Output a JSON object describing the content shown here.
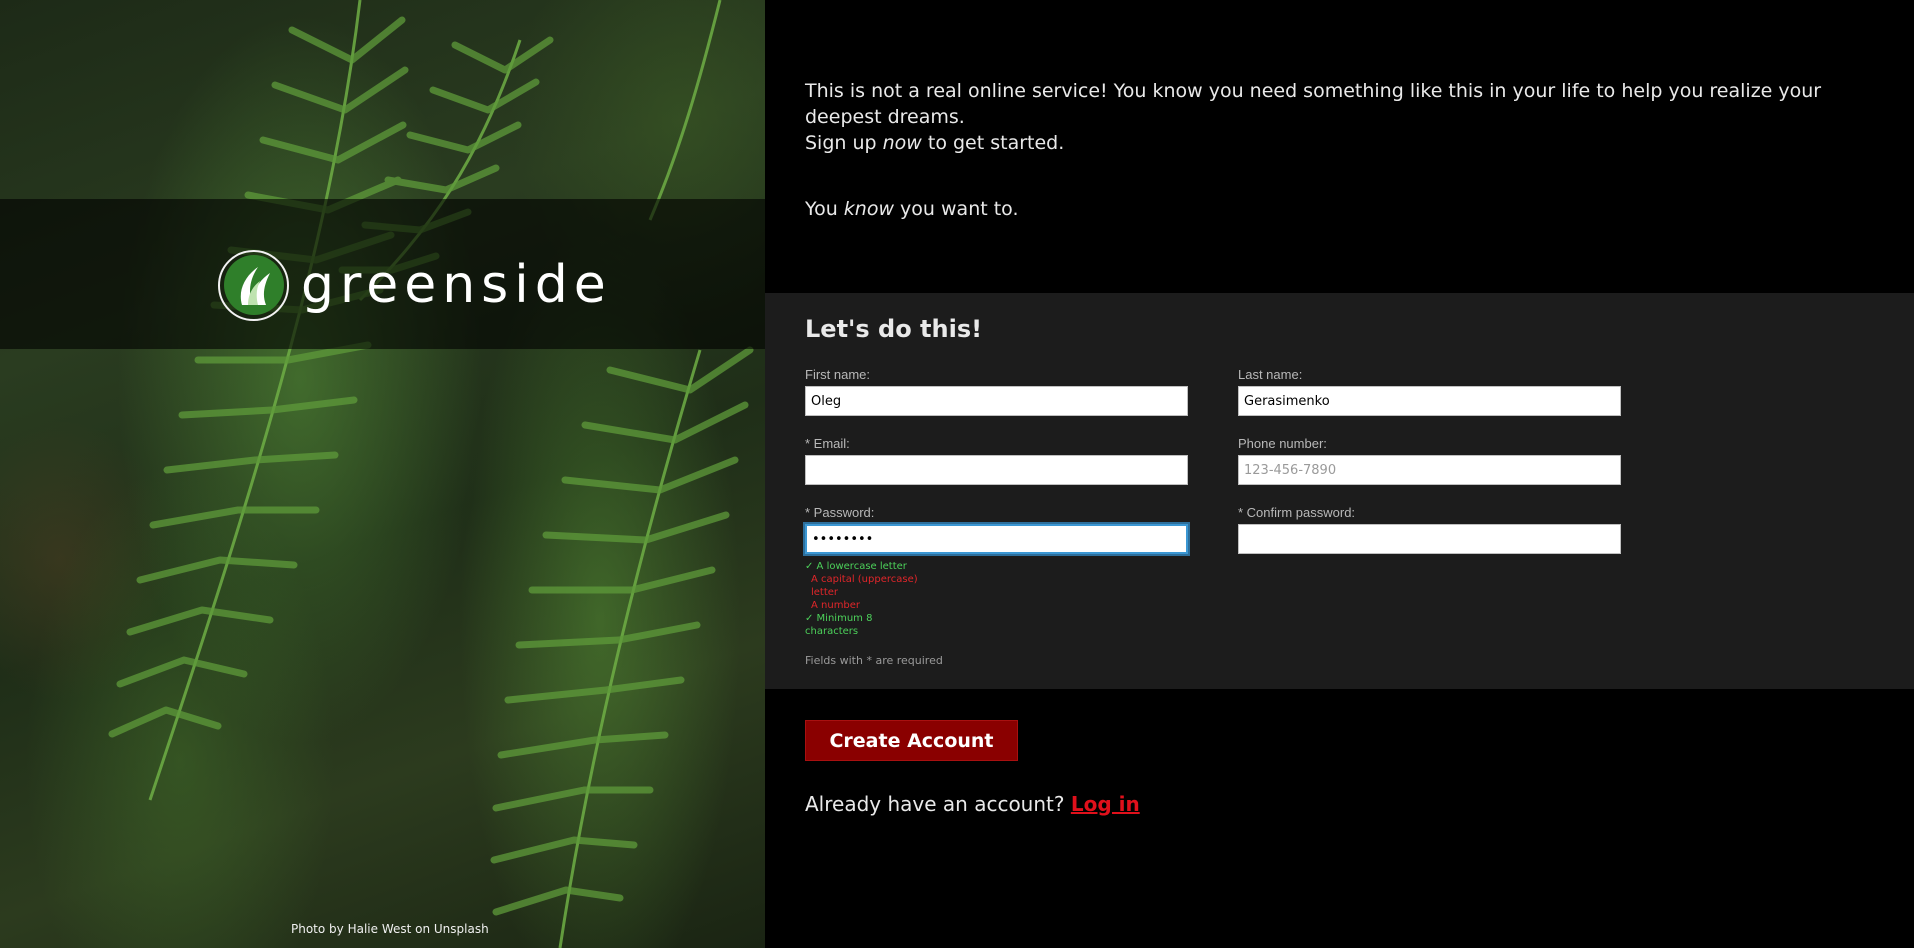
{
  "brand": {
    "name": "greenside",
    "photo_credit": "Photo by Halie West on Unsplash"
  },
  "intro": {
    "line1": "This is not a real online service! You know you need something like this in your life to help you realize your deepest dreams.",
    "line2_prefix": "Sign up ",
    "line2_emphasis": "now",
    "line2_suffix": " to get started.",
    "tagline_prefix": "You ",
    "tagline_emphasis": "know",
    "tagline_suffix": " you want to."
  },
  "form": {
    "title": "Let's do this!",
    "first_name": {
      "label": "First name:",
      "value": "Oleg"
    },
    "last_name": {
      "label": "Last name:",
      "value": "Gerasimenko"
    },
    "email": {
      "label": "* Email:",
      "value": ""
    },
    "phone": {
      "label": "Phone number:",
      "placeholder": "123-456-7890",
      "value": ""
    },
    "password": {
      "label": "* Password:",
      "value": "••••••••"
    },
    "confirm_password": {
      "label": "* Confirm password:",
      "value": ""
    },
    "password_rules": [
      {
        "text": "✓  A lowercase letter",
        "status": "ok"
      },
      {
        "text": "A capital (uppercase) letter",
        "status": "bad"
      },
      {
        "text": "A number",
        "status": "bad"
      },
      {
        "text": "✓  Minimum 8 characters",
        "status": "ok"
      }
    ],
    "required_note": "Fields with * are required"
  },
  "actions": {
    "create_label": "Create Account",
    "login_prompt": "Already have an account? ",
    "login_label": "Log in"
  },
  "colors": {
    "accent_red": "#8a0000",
    "link_red": "#e0101b",
    "rule_ok": "#4cd05a",
    "rule_bad": "#e0262a",
    "focus_blue": "#3b97d3"
  }
}
